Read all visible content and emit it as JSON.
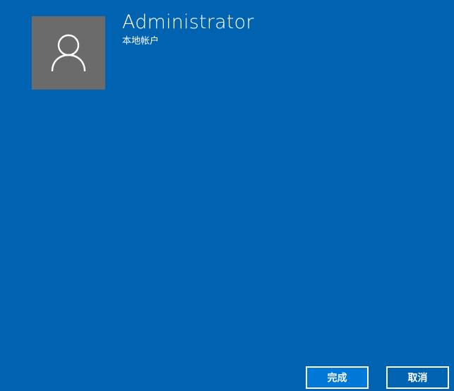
{
  "account": {
    "name": "Administrator",
    "type": "本地帐户",
    "avatar_icon": "user-icon"
  },
  "buttons": {
    "finish_label": "完成",
    "cancel_label": "取消"
  },
  "colors": {
    "background": "#0063b1",
    "avatar_bg": "#6b6b6b",
    "primary_button": "#0078d7",
    "text": "#ffffff"
  }
}
